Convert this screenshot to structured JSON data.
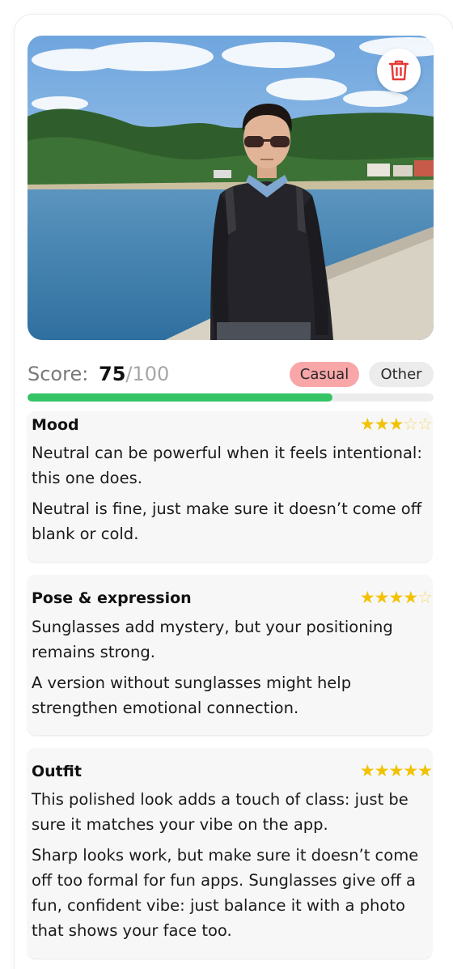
{
  "score": {
    "label": "Score:",
    "value": "75",
    "max": "/100",
    "percent": 75,
    "bar_color": "#34c466"
  },
  "tags": [
    {
      "label": "Casual",
      "color": "#f8a6a8"
    },
    {
      "label": "Other",
      "color": "#ececec"
    }
  ],
  "photo": {
    "delete_icon": "trash-icon",
    "accent": "#e53935"
  },
  "sections": [
    {
      "title": "Mood",
      "rating": 3,
      "paragraphs": [
        "Neutral can be powerful when it feels intentional: this one does.",
        "Neutral is fine, just make sure it doesn’t come off blank or cold."
      ]
    },
    {
      "title": "Pose & expression",
      "rating": 4,
      "paragraphs": [
        "Sunglasses add mystery, but your positioning remains strong.",
        "A version without sunglasses might help strengthen emotional connection."
      ]
    },
    {
      "title": "Outfit",
      "rating": 5,
      "paragraphs": [
        "This polished look adds a touch of class: just be sure it matches your vibe on the app.",
        "Sharp looks work, but make sure it doesn’t come off too formal for fun apps. Sunglasses give off a fun, confident vibe: just balance it with a photo that shows your face too."
      ]
    }
  ]
}
